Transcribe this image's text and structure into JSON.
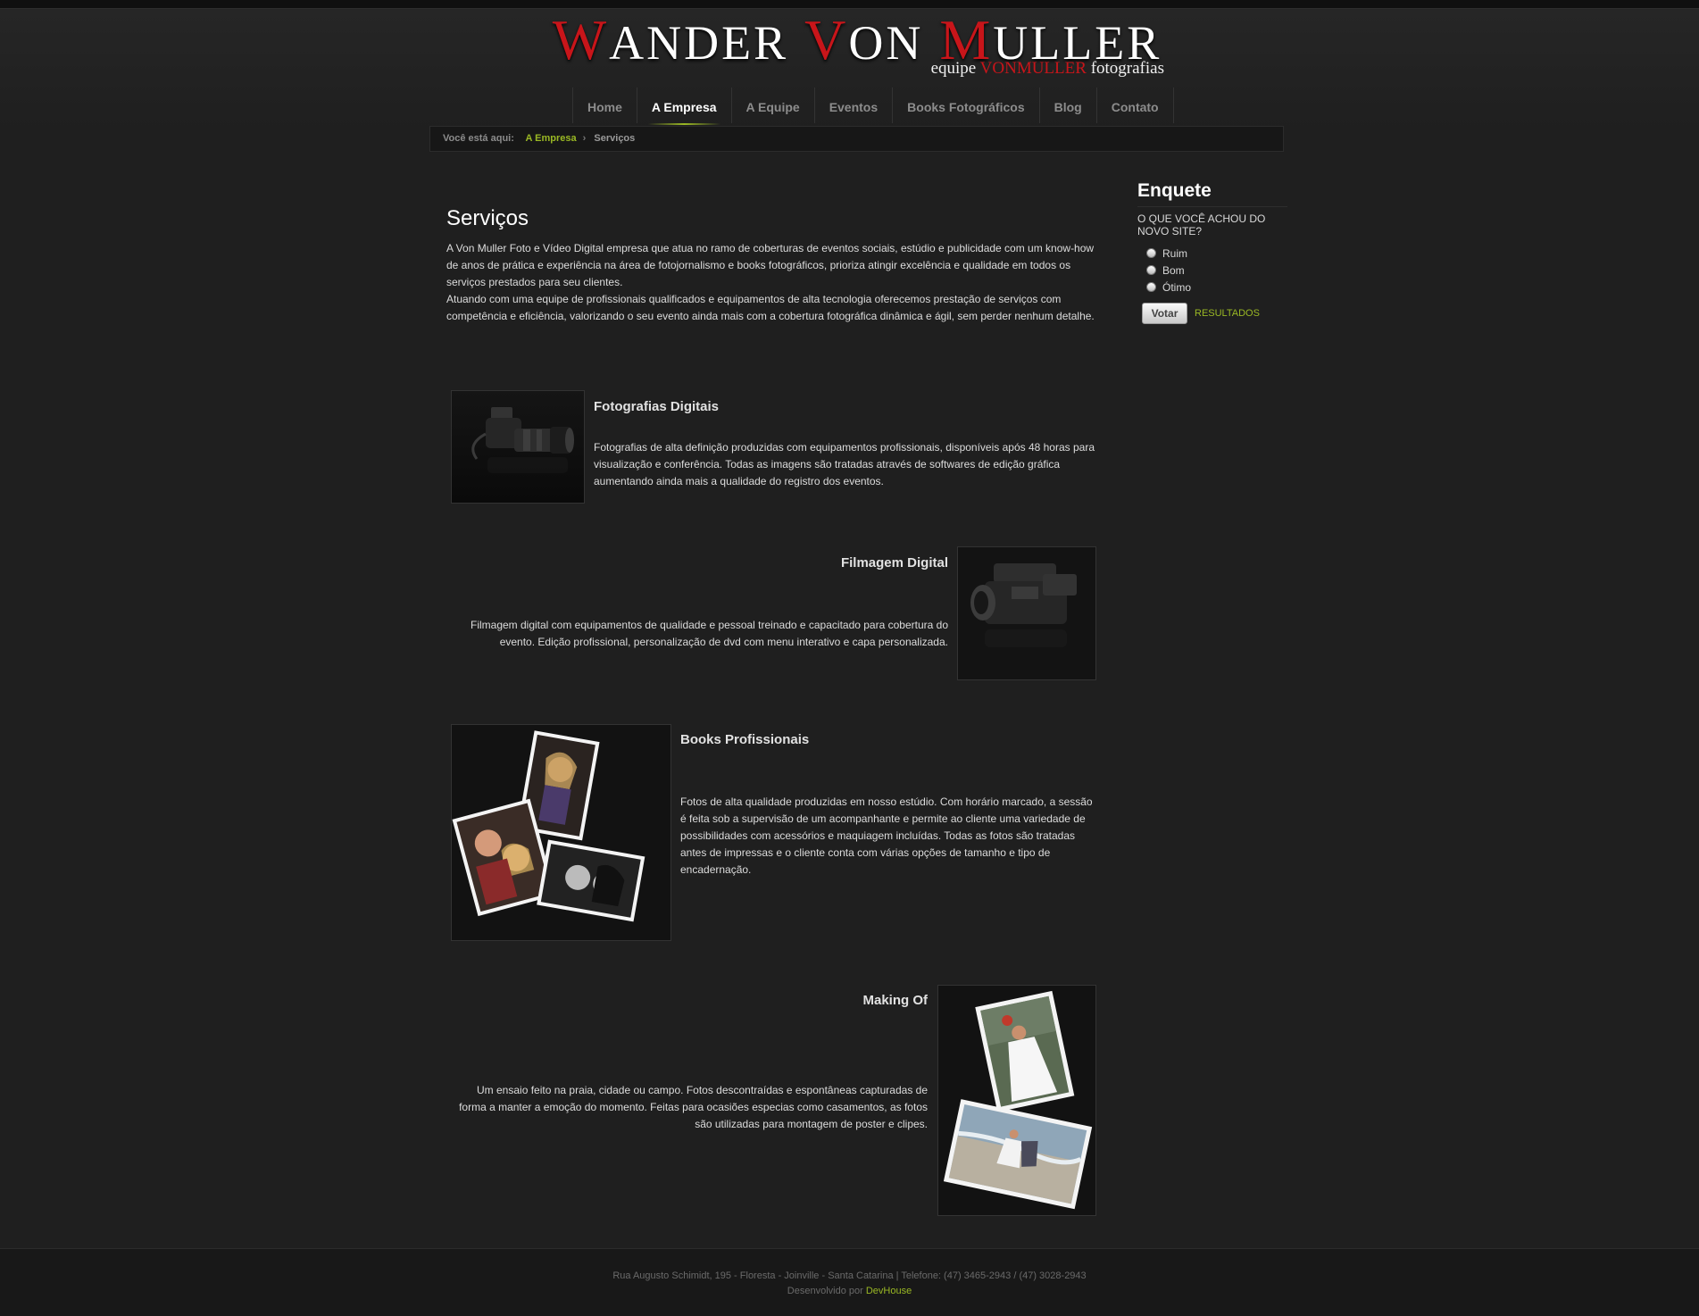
{
  "logo": {
    "title_words": [
      {
        "cap": "W",
        "rest": "ANDER"
      },
      {
        "cap": "V",
        "rest": "ON"
      },
      {
        "cap": "M",
        "rest": "ULLER"
      }
    ],
    "tagline_pre": "equipe",
    "tagline_brand": "VONMULLER",
    "tagline_post": "fotografias"
  },
  "nav": {
    "items": [
      {
        "label": "Home",
        "active": false
      },
      {
        "label": "A Empresa",
        "active": true
      },
      {
        "label": "A Equipe",
        "active": false
      },
      {
        "label": "Eventos",
        "active": false
      },
      {
        "label": "Books Fotográficos",
        "active": false
      },
      {
        "label": "Blog",
        "active": false
      },
      {
        "label": "Contato",
        "active": false
      }
    ]
  },
  "breadcrumb": {
    "label": "Você está aqui:",
    "link": "A Empresa",
    "separator": "›",
    "current": "Serviços"
  },
  "main": {
    "title": "Serviços",
    "intro_1": "A Von Muller Foto e Vídeo Digital empresa que atua no ramo de coberturas de eventos sociais, estúdio e publicidade com um know-how de anos de prática e experiência na área de fotojornalismo e books fotográficos, prioriza atingir excelência e qualidade em todos os serviços prestados para seu clientes.",
    "intro_2": "Atuando com uma equipe de profissionais qualificados e equipamentos de alta tecnologia oferecemos prestação de serviços com competência e eficiência, valorizando o seu evento ainda mais com a cobertura fotográfica dinâmica e ágil, sem perder nenhum detalhe.",
    "services": [
      {
        "title": "Fotografias Digitais",
        "text": "Fotografias de alta definição produzidas com equipamentos profissionais, disponíveis após 48 horas para visualização e conferência. Todas as imagens são tratadas através de softwares de edição gráfica aumentando ainda mais a qualidade do registro dos eventos."
      },
      {
        "title": "Filmagem Digital",
        "text": "Filmagem digital com equipamentos de qualidade e pessoal treinado e capacitado para cobertura do evento. Edição profissional, personalização de dvd com menu interativo e capa personalizada."
      },
      {
        "title": "Books Profissionais",
        "text": "Fotos de alta qualidade produzidas em nosso estúdio. Com horário marcado, a sessão é feita sob a supervisão de um acompanhante e permite ao cliente uma variedade de possibilidades com acessórios e maquiagem incluídas. Todas as fotos são tratadas antes de impressas e o cliente conta com várias opções de tamanho e tipo de encadernação."
      },
      {
        "title": "Making Of",
        "text": "Um ensaio feito na praia, cidade ou campo. Fotos descontraídas e espontâneas capturadas de forma a manter a emoção do momento. Feitas para ocasiões especias como casamentos, as fotos são utilizadas para montagem de poster e clipes."
      }
    ]
  },
  "poll": {
    "title": "Enquete",
    "question": "O QUE VOCÊ ACHOU DO NOVO SITE?",
    "options": [
      "Ruim",
      "Bom",
      "Ótimo"
    ],
    "vote_label": "Votar",
    "results_label": "RESULTADOS"
  },
  "footer": {
    "address": "Rua Augusto Schimidt, 195 - Floresta - Joinville - Santa Catarina | Telefone: (47) 3465-2943 / (47) 3028-2943",
    "dev_prefix": "Desenvolvido por",
    "dev_link": "DevHouse"
  },
  "colors": {
    "accent_green": "#9ab824",
    "brand_red": "#c8151a",
    "background": "#1f1f1f"
  }
}
